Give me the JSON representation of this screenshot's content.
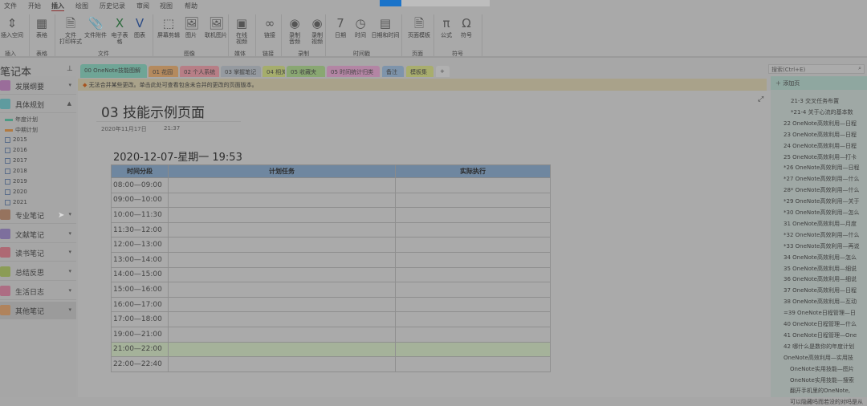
{
  "menu": [
    "文件",
    "开始",
    "插入",
    "绘图",
    "历史记录",
    "审阅",
    "视图",
    "帮助"
  ],
  "ribbon": {
    "buttons": [
      {
        "label": "插入空间",
        "icon": "insert-space-icon",
        "glyph": "⇕"
      },
      {
        "label": "表格",
        "icon": "table-icon",
        "glyph": "▦"
      },
      {
        "label": "文件\n打印样式",
        "icon": "printout-icon",
        "glyph": "🗎"
      },
      {
        "label": "文件附件",
        "icon": "attachment-icon",
        "glyph": "📎"
      },
      {
        "label": "电子表格",
        "icon": "spreadsheet-icon",
        "glyph": "X"
      },
      {
        "label": "图表",
        "icon": "diagram-icon",
        "glyph": "V"
      },
      {
        "label": "屏幕剪辑",
        "icon": "screen-clip-icon",
        "glyph": "⬚"
      },
      {
        "label": "图片",
        "icon": "picture-icon",
        "glyph": "🖼"
      },
      {
        "label": "联机图片",
        "icon": "online-picture-icon",
        "glyph": "🖼"
      },
      {
        "label": "在线\n视频",
        "icon": "online-video-icon",
        "glyph": "▣"
      },
      {
        "label": "链接",
        "icon": "link-icon",
        "glyph": "∞"
      },
      {
        "label": "录制\n音频",
        "icon": "record-audio-icon",
        "glyph": "◉"
      },
      {
        "label": "录制\n视频",
        "icon": "record-video-icon",
        "glyph": "◉"
      },
      {
        "label": "日期",
        "icon": "date-icon",
        "glyph": "7"
      },
      {
        "label": "时间",
        "icon": "clock-icon",
        "glyph": "◷"
      },
      {
        "label": "日期和时间",
        "icon": "datetime-icon",
        "glyph": "▤"
      },
      {
        "label": "页面模板",
        "icon": "page-template-icon",
        "glyph": "🗎"
      },
      {
        "label": "公式",
        "icon": "equation-icon",
        "glyph": "π"
      },
      {
        "label": "符号",
        "icon": "symbol-icon",
        "glyph": "Ω"
      }
    ],
    "groups": [
      "插入",
      "表格",
      "文件",
      "图像",
      "媒体",
      "链接",
      "录制",
      "时间戳",
      "页面",
      "符号"
    ]
  },
  "notebook": {
    "title": "笔记本"
  },
  "tabs": [
    {
      "label": "00 OneNote技能图解",
      "color": "#6fa596"
    },
    {
      "label": "01 花园",
      "color": "#b48a5e"
    },
    {
      "label": "02 个人系统",
      "color": "#b77e86"
    },
    {
      "label": "03 掌握笔记",
      "color": "#959aa0"
    },
    {
      "label": "04 相关",
      "color": "#a5ad6c"
    },
    {
      "label": "05 收藏夹",
      "color": "#89a772"
    },
    {
      "label": "05 时间统计归类",
      "color": "#b385a4"
    },
    {
      "label": "备注",
      "color": "#7e94ab"
    },
    {
      "label": "模板集",
      "color": "#a8ad6d"
    },
    {
      "label": "+",
      "color": "#b0b0b0"
    }
  ],
  "search": {
    "placeholder": "搜索(Ctrl+E)"
  },
  "sections": [
    {
      "label": "发展纲要",
      "color": "#9a6d9a"
    },
    {
      "label": "具体规划",
      "color": "#5f9b9f"
    },
    {
      "label": "专业笔记",
      "color": "#96735e"
    },
    {
      "label": "文献笔记",
      "color": "#7d6f9d"
    },
    {
      "label": "读书笔记",
      "color": "#ae6973"
    },
    {
      "label": "总结反思",
      "color": "#8b9c56"
    },
    {
      "label": "生活日志",
      "color": "#ad6d83"
    },
    {
      "label": "其他笔记",
      "color": "#b0835c"
    }
  ],
  "subsections": [
    "年度计划",
    "中期计划",
    "2015",
    "2016",
    "2017",
    "2018",
    "2019",
    "2020",
    "2021"
  ],
  "infobar": {
    "text": "无法合并某些更改。单击此处可查看包含未合并的更改的页面版本。"
  },
  "page": {
    "title": "03 技能示例页面",
    "date": "2020年11月17日",
    "time": "21:37",
    "subtitle": "2020-12-07-星期一 19:53",
    "table": {
      "headers": [
        "时间分段",
        "计划任务",
        "实际执行"
      ],
      "rows": [
        "08:00—09:00",
        "09:00—10:00",
        "10:00—11:30",
        "11:30—12:00",
        "12:00—13:00",
        "13:00—14:00",
        "14:00—15:00",
        "15:00—16:00",
        "16:00—17:00",
        "17:00—18:00",
        "19:00—21:00",
        "21:00—22:00",
        "22:00—22:40"
      ],
      "highlighted_row": 11
    }
  },
  "pages_panel": {
    "add_label": "添加页",
    "items": [
      {
        "t": "21-3 交叉任务布置",
        "i": 2
      },
      {
        "t": "*21-4  关于心流的基本数",
        "i": 2
      },
      {
        "t": "22 OneNote高效利用—日程",
        "i": 0
      },
      {
        "t": "23 OneNote高效利用—日程",
        "i": 0
      },
      {
        "t": "24 OneNote高效利用—日程",
        "i": 0
      },
      {
        "t": "25 OneNote高效利用—打卡",
        "i": 0
      },
      {
        "t": "*26 OneNote高效利用—日程",
        "i": 0
      },
      {
        "t": "*27 OneNote高效利用—什么",
        "i": 0
      },
      {
        "t": "28* OneNote高效利用—什么",
        "i": 0
      },
      {
        "t": "*29 OneNote高效利用—关于",
        "i": 0
      },
      {
        "t": "*30 OneNote高效利用—怎么",
        "i": 0
      },
      {
        "t": "31 OneNote高效利用—月度",
        "i": 0
      },
      {
        "t": "*32 OneNote高效利用—什么",
        "i": 0
      },
      {
        "t": "*33 OneNote高效利用—再说",
        "i": 0
      },
      {
        "t": "34 OneNote高效利用—怎么",
        "i": 0
      },
      {
        "t": "35 OneNote高效利用—细说",
        "i": 0
      },
      {
        "t": "36 OneNote高效利用—细说",
        "i": 0
      },
      {
        "t": "37 OneNote高效利用—日程",
        "i": 0
      },
      {
        "t": "38 OneNote高效利用—互动",
        "i": 0
      },
      {
        "t": "=39 OneNote日程管理—日",
        "i": 0
      },
      {
        "t": "40 OneNote日程管理—什么",
        "i": 0
      },
      {
        "t": "41 OneNote日程管理—One",
        "i": 0
      },
      {
        "t": "42 哪什么是数你的年度计划",
        "i": 0
      },
      {
        "t": "OneNote高效利用—实用技",
        "i": 0
      },
      {
        "t": "OneNote实用技能—图片",
        "i": 1
      },
      {
        "t": "OneNote实用技能—搜索",
        "i": 1
      },
      {
        "t": "翻开手机里的OneNote,",
        "i": 1
      },
      {
        "t": "可以隐藏吗而若没的对吗是从",
        "i": 1
      }
    ]
  }
}
